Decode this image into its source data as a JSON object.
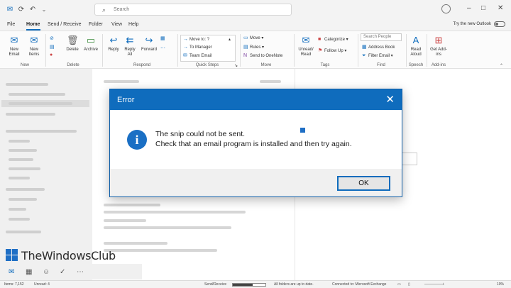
{
  "window": {
    "search_placeholder": "Search",
    "try_new_outlook": "Try the new Outlook"
  },
  "menu": {
    "items": [
      "File",
      "Home",
      "Send / Receive",
      "Folder",
      "View",
      "Help"
    ]
  },
  "ribbon": {
    "new_email": "New Email",
    "new_items": "New Items",
    "delete": "Delete",
    "archive": "Archive",
    "reply": "Reply",
    "reply_all": "Reply All",
    "forward": "Forward",
    "move_to": "Move to: ?",
    "to_manager": "To Manager",
    "team_email": "Team Email",
    "move": "Move",
    "rules": "Rules",
    "send_to_onenote": "Send to OneNote",
    "unread_read": "Unread/ Read",
    "categorize": "Categorize",
    "follow_up": "Follow Up",
    "search_people": "Search People",
    "address_book": "Address Book",
    "filter_email": "Filter Email",
    "read_aloud": "Read Aloud",
    "get_addins": "Get Add-ins",
    "groups": {
      "new": "New",
      "delete": "Delete",
      "respond": "Respond",
      "quick_steps": "Quick Steps",
      "move": "Move",
      "tags": "Tags",
      "find": "Find",
      "speech": "Speech",
      "addins": "Add-ins"
    }
  },
  "dialog": {
    "title": "Error",
    "message_line1": "The snip could not be sent.",
    "message_line2": "Check that an email program is installed and then try again.",
    "ok_label": "OK",
    "inner_watermark": "The WindowsClub"
  },
  "watermark": {
    "text": "TheWindowsClub"
  },
  "status": {
    "items": "Items: 7,152",
    "unread": "Unread: 4",
    "send_receive": "Send/Receive",
    "folders_up_to_date": "All folders are up to date.",
    "connected": "Connected to: Microsoft Exchange",
    "zoom": "10%"
  },
  "colors": {
    "accent": "#0f6cbd"
  }
}
